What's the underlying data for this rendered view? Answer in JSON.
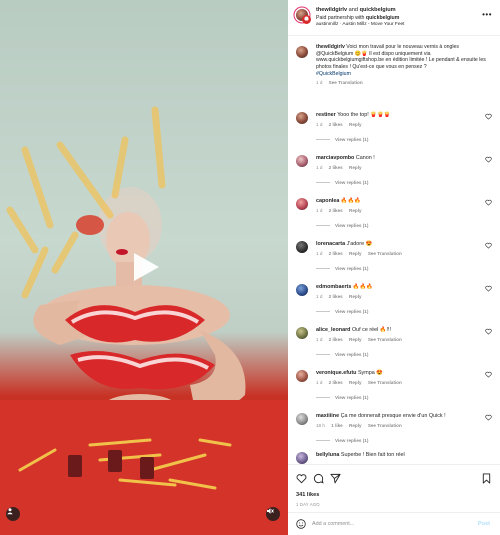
{
  "header": {
    "author": "thewildgirlv",
    "and_text": "and",
    "coauthor": "quickbelgium",
    "partnership_prefix": "Paid partnership with",
    "partner": "quickbelgium",
    "audio": "austinmillz · Austin Millz - Move Your Feet",
    "more_icon": "more-horizontal-icon"
  },
  "caption": {
    "username": "thewildgirlv",
    "text": "Voici mon travail pour le nouveau vernis à ongles @QuickBelgium 😊🍟 Il est dispo uniquement via www.quickbelgiumgiftshop.be en édition limitée ! Le pendant & ensuite les photos finales ! Qu'est-ce que vous en pensez ?",
    "hashtag": "#QuickBelgium",
    "time": "1 d",
    "see_translation": "See Translation"
  },
  "comments": [
    {
      "username": "restiner",
      "text": "Yooo the top! 🍟🍟🍟",
      "time": "1 d",
      "likes": "2 likes",
      "reply": "Reply",
      "see_translation": "",
      "replies": "View replies (1)"
    },
    {
      "username": "marciavpombo",
      "text": "Canon !",
      "time": "1 d",
      "likes": "2 likes",
      "reply": "Reply",
      "see_translation": "",
      "replies": "View replies (1)"
    },
    {
      "username": "caponlea",
      "text": "🔥🔥🔥",
      "time": "1 d",
      "likes": "2 likes",
      "reply": "Reply",
      "see_translation": "",
      "replies": "View replies (1)"
    },
    {
      "username": "lorenacarta",
      "text": "J'adore 😍",
      "time": "1 d",
      "likes": "2 likes",
      "reply": "Reply",
      "see_translation": "See Translation",
      "replies": "View replies (1)"
    },
    {
      "username": "edmombaerts",
      "text": "🔥🔥🔥",
      "time": "1 d",
      "likes": "2 likes",
      "reply": "Reply",
      "see_translation": "",
      "replies": "View replies (1)"
    },
    {
      "username": "alice_leonard",
      "text": "Ouf ce réel 🔥!!!",
      "time": "1 d",
      "likes": "2 likes",
      "reply": "Reply",
      "see_translation": "See Translation",
      "replies": "View replies (1)"
    },
    {
      "username": "veronique.efutu",
      "text": "Sympa 😍",
      "time": "1 d",
      "likes": "2 likes",
      "reply": "Reply",
      "see_translation": "See Translation",
      "replies": "View replies (1)"
    },
    {
      "username": "maxiiiine",
      "text": "Ça me donnerait presque envie d'un Quick !",
      "time": "18 h",
      "likes": "1 like",
      "reply": "Reply",
      "see_translation": "See Translation",
      "replies": "View replies (1)"
    },
    {
      "username": "bellyluna",
      "text": "Superbe ! Bien fait ton réel",
      "time": "",
      "likes": "",
      "reply": "",
      "see_translation": "",
      "replies": ""
    }
  ],
  "actions": {
    "likes": "341 likes",
    "time_ago": "1 DAY AGO",
    "icons": [
      "heart-icon",
      "comment-icon",
      "share-icon",
      "bookmark-icon"
    ]
  },
  "add_comment": {
    "placeholder": "Add a comment...",
    "post_label": "Post",
    "emoji_icon": "emoji-icon"
  },
  "media": {
    "play_icon": "play-icon",
    "user_tag_icon": "user-tag-icon",
    "mute_icon": "mute-icon"
  },
  "colors": {
    "accent_link": "#00376b",
    "post_button": "#b2dffc",
    "secondary_text": "#8e8e8e",
    "quick_red": "#d6362a"
  }
}
